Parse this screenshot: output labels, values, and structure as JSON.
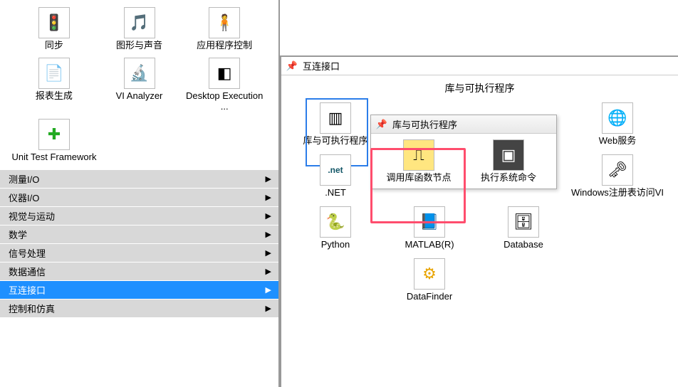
{
  "left": {
    "icons": [
      {
        "label": "同步",
        "glyph": "🚦"
      },
      {
        "label": "图形与声音",
        "glyph": "🎵"
      },
      {
        "label": "应用程序控制",
        "glyph": "🧍"
      },
      {
        "label": "报表生成",
        "glyph": "📄"
      },
      {
        "label": "VI Analyzer",
        "glyph": "🔬"
      },
      {
        "label": "Desktop Execution ...",
        "glyph": "◧"
      },
      {
        "label": "Unit Test Framework",
        "glyph": "✚"
      }
    ],
    "menu": [
      "测量I/O",
      "仪器I/O",
      "视觉与运动",
      "数学",
      "信号处理",
      "数据通信",
      "互连接口",
      "控制和仿真"
    ],
    "menu_active_index": 6
  },
  "flyout": {
    "title": "互连接口",
    "section_title": "库与可执行程序",
    "items": [
      {
        "label": "库与可执行程序",
        "glyph": "▥"
      },
      {
        "label": "",
        "glyph": "🗔"
      },
      {
        "label": "",
        "glyph": ""
      },
      {
        "label": "Web服务",
        "glyph": "🌐"
      },
      {
        "label": ".NET",
        "glyph": ".net"
      },
      {
        "label": "",
        "glyph": ""
      },
      {
        "label": "",
        "glyph": ""
      },
      {
        "label": "Windows注册表访问VI",
        "glyph": "🗝"
      },
      {
        "label": "Python",
        "glyph": "🐍"
      },
      {
        "label": "MATLAB(R)",
        "glyph": "📘"
      },
      {
        "label": "Database",
        "glyph": "🗄"
      },
      {
        "label": "",
        "glyph": ""
      },
      {
        "label": "",
        "glyph": ""
      },
      {
        "label": "DataFinder",
        "glyph": "⚙"
      },
      {
        "label": "",
        "glyph": ""
      },
      {
        "label": "",
        "glyph": ""
      }
    ]
  },
  "subflyout": {
    "title": "库与可执行程序",
    "items": [
      {
        "label": "调用库函数节点",
        "glyph": "⎍"
      },
      {
        "label": "执行系统命令",
        "glyph": "▣"
      }
    ]
  }
}
